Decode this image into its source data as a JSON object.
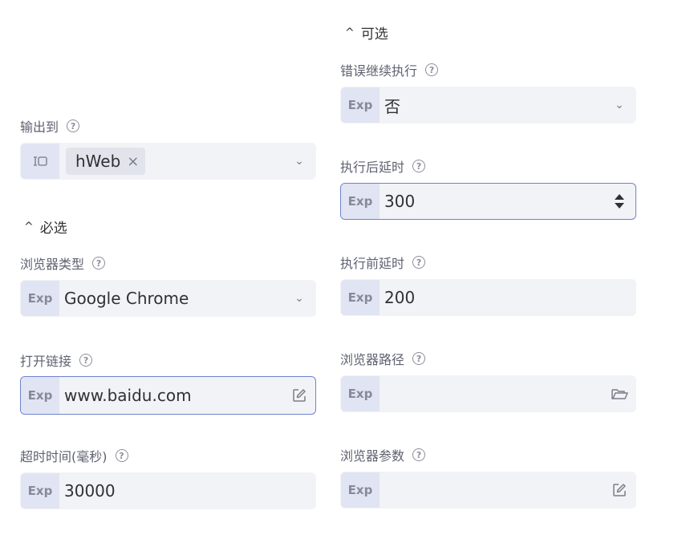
{
  "left": {
    "output": {
      "label": "输出到",
      "tag": "hWeb"
    },
    "required_section": {
      "label": "必选"
    },
    "browser_type": {
      "label": "浏览器类型",
      "value": "Google Chrome"
    },
    "open_link": {
      "label": "打开链接",
      "value": "www.baidu.com"
    },
    "timeout": {
      "label": "超时时间(毫秒)",
      "value": "30000"
    }
  },
  "right": {
    "optional_section": {
      "label": "可选"
    },
    "continue_on_error": {
      "label": "错误继续执行",
      "value": "否"
    },
    "delay_after": {
      "label": "执行后延时",
      "value": "300"
    },
    "delay_before": {
      "label": "执行前延时",
      "value": "200"
    },
    "browser_path": {
      "label": "浏览器路径",
      "value": ""
    },
    "browser_args": {
      "label": "浏览器参数",
      "value": ""
    }
  },
  "common": {
    "exp_badge": "Exp",
    "help_glyph": "?",
    "caret_glyph": "^",
    "chevron_glyph": "⌄",
    "remove_glyph": "×"
  },
  "colors": {
    "field_bg": "#f2f3f7",
    "exp_bg": "#e1e4f2",
    "focus_border": "#6f82cc"
  },
  "icons": [
    "help-icon",
    "chevron-down-icon",
    "variable-icon",
    "close-icon",
    "edit-icon",
    "folder-icon",
    "spinner-arrows-icon"
  ]
}
